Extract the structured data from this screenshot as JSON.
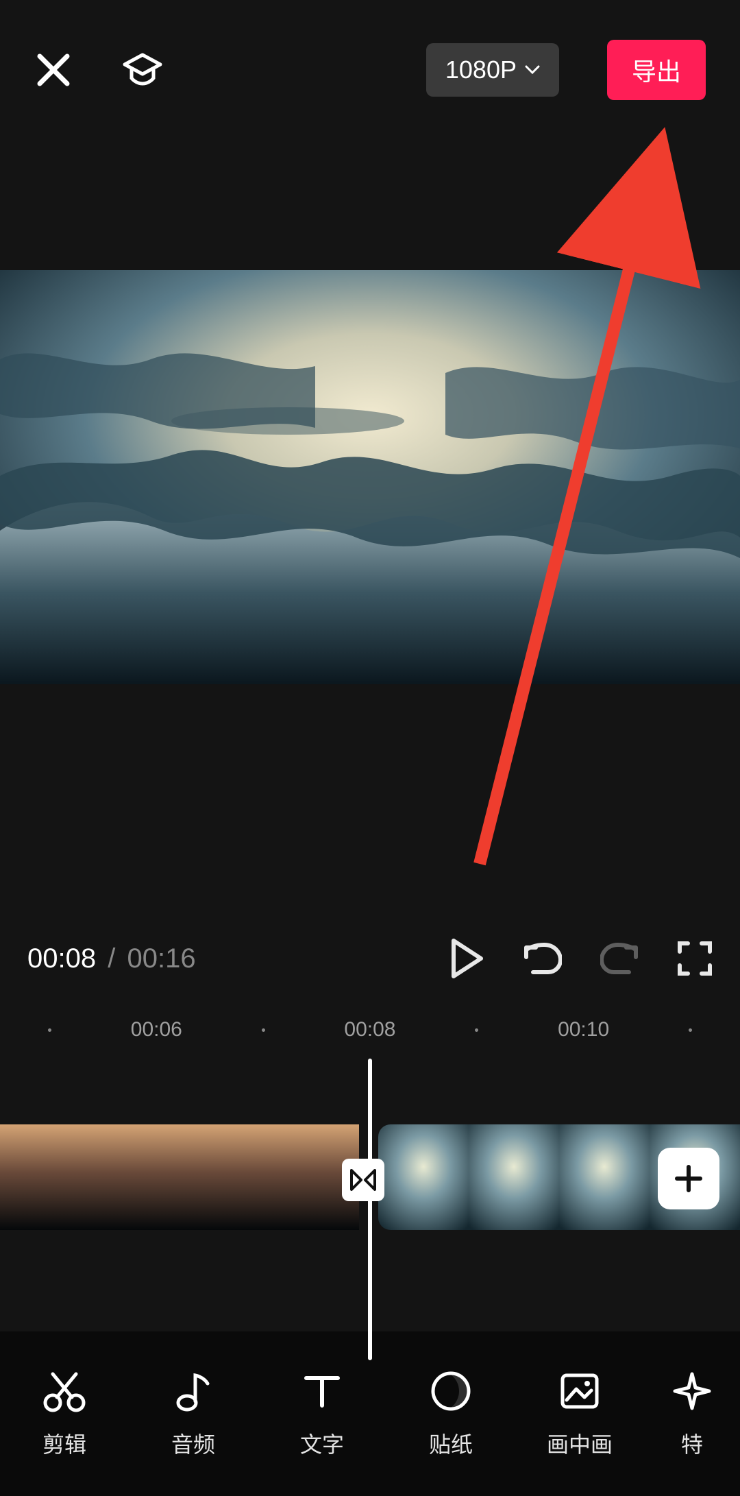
{
  "header": {
    "resolution_label": "1080P",
    "export_label": "导出"
  },
  "transport": {
    "current_time": "00:08",
    "separator": "/",
    "duration": "00:16"
  },
  "ruler": {
    "ticks": [
      "00:06",
      "00:08",
      "00:10"
    ]
  },
  "toolbar": {
    "items": [
      {
        "id": "edit",
        "label": "剪辑",
        "icon": "scissors"
      },
      {
        "id": "audio",
        "label": "音频",
        "icon": "music-note"
      },
      {
        "id": "text",
        "label": "文字",
        "icon": "text-t"
      },
      {
        "id": "sticker",
        "label": "贴纸",
        "icon": "moon"
      },
      {
        "id": "pip",
        "label": "画中画",
        "icon": "image-frame"
      },
      {
        "id": "effect",
        "label": "特",
        "icon": "sparkle"
      }
    ]
  },
  "colors": {
    "accent": "#ff1e56"
  }
}
